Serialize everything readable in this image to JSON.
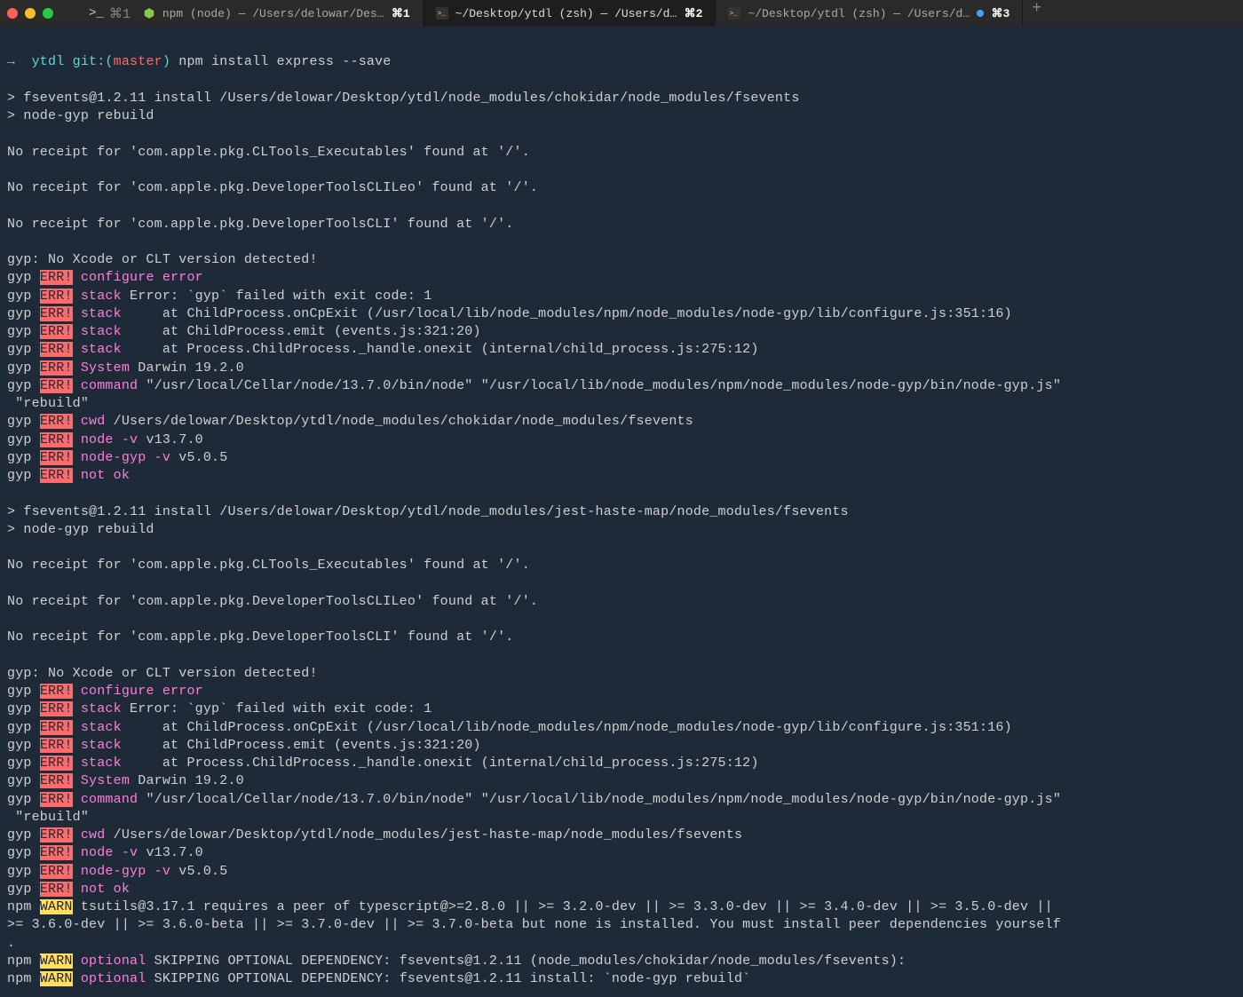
{
  "titlebar": {
    "prompt": "⌘1"
  },
  "tabs": [
    {
      "title": "npm (node) — /Users/delowar/Desktop/ytdl",
      "kbd": "⌘1",
      "type": "node",
      "active": false
    },
    {
      "title": "~/Desktop/ytdl (zsh) — /Users/delowar/Desktop/...",
      "kbd": "⌘2",
      "type": "zsh",
      "active": true
    },
    {
      "title": "~/Desktop/ytdl (zsh) — /Users/delowar/Deskt...",
      "kbd": "⌘3",
      "type": "zsh",
      "active": false,
      "dot": true
    }
  ],
  "prompt": {
    "arrow": "→",
    "dir": "ytdl",
    "git_label": "git:(",
    "branch": "master",
    "git_close": ")",
    "command": "npm install express --save"
  },
  "lines": {
    "l1": "> fsevents@1.2.11 install /Users/delowar/Desktop/ytdl/node_modules/chokidar/node_modules/fsevents",
    "l2": "> node-gyp rebuild",
    "l3": "No receipt for 'com.apple.pkg.CLTools_Executables' found at '/'.",
    "l4": "No receipt for 'com.apple.pkg.DeveloperToolsCLILeo' found at '/'.",
    "l5": "No receipt for 'com.apple.pkg.DeveloperToolsCLI' found at '/'.",
    "l6": "gyp: No Xcode or CLT version detected!",
    "gyp_label": "gyp",
    "err_label": "ERR!",
    "conf_err": "configure error",
    "stack_label": "stack",
    "stack1": " Error: `gyp` failed with exit code: 1",
    "stack2": "     at ChildProcess.onCpExit (/usr/local/lib/node_modules/npm/node_modules/node-gyp/lib/configure.js:351:16)",
    "stack3": "     at ChildProcess.emit (events.js:321:20)",
    "stack4": "     at Process.ChildProcess._handle.onexit (internal/child_process.js:275:12)",
    "system_label": "System",
    "system_val": " Darwin 19.2.0",
    "command_label": "command",
    "command_val": " \"/usr/local/Cellar/node/13.7.0/bin/node\" \"/usr/local/lib/node_modules/npm/node_modules/node-gyp/bin/node-gyp.js\"",
    "rebuild": " \"rebuild\"",
    "cwd_label": "cwd",
    "cwd_val1": " /Users/delowar/Desktop/ytdl/node_modules/chokidar/node_modules/fsevents",
    "cwd_val2": " /Users/delowar/Desktop/ytdl/node_modules/jest-haste-map/node_modules/fsevents",
    "nodev_label": "node -v",
    "nodev_val": " v13.7.0",
    "gypv_label": "node-gyp -v",
    "gypv_val": " v5.0.5",
    "notok": "not ok",
    "l7": "> fsevents@1.2.11 install /Users/delowar/Desktop/ytdl/node_modules/jest-haste-map/node_modules/fsevents",
    "npm_label": "npm",
    "warn_label": "WARN",
    "optional_label": "optional",
    "warn1": " tsutils@3.17.1 requires a peer of typescript@>=2.8.0 || >= 3.2.0-dev || >= 3.3.0-dev || >= 3.4.0-dev || >= 3.5.0-dev ||",
    "warn1b": ">= 3.6.0-dev || >= 3.6.0-beta || >= 3.7.0-dev || >= 3.7.0-beta but none is installed. You must install peer dependencies yourself",
    "warn1c": ".",
    "warn2": " SKIPPING OPTIONAL DEPENDENCY: fsevents@1.2.11 (node_modules/chokidar/node_modules/fsevents):",
    "warn3": " SKIPPING OPTIONAL DEPENDENCY: fsevents@1.2.11 install: `node-gyp rebuild`"
  }
}
